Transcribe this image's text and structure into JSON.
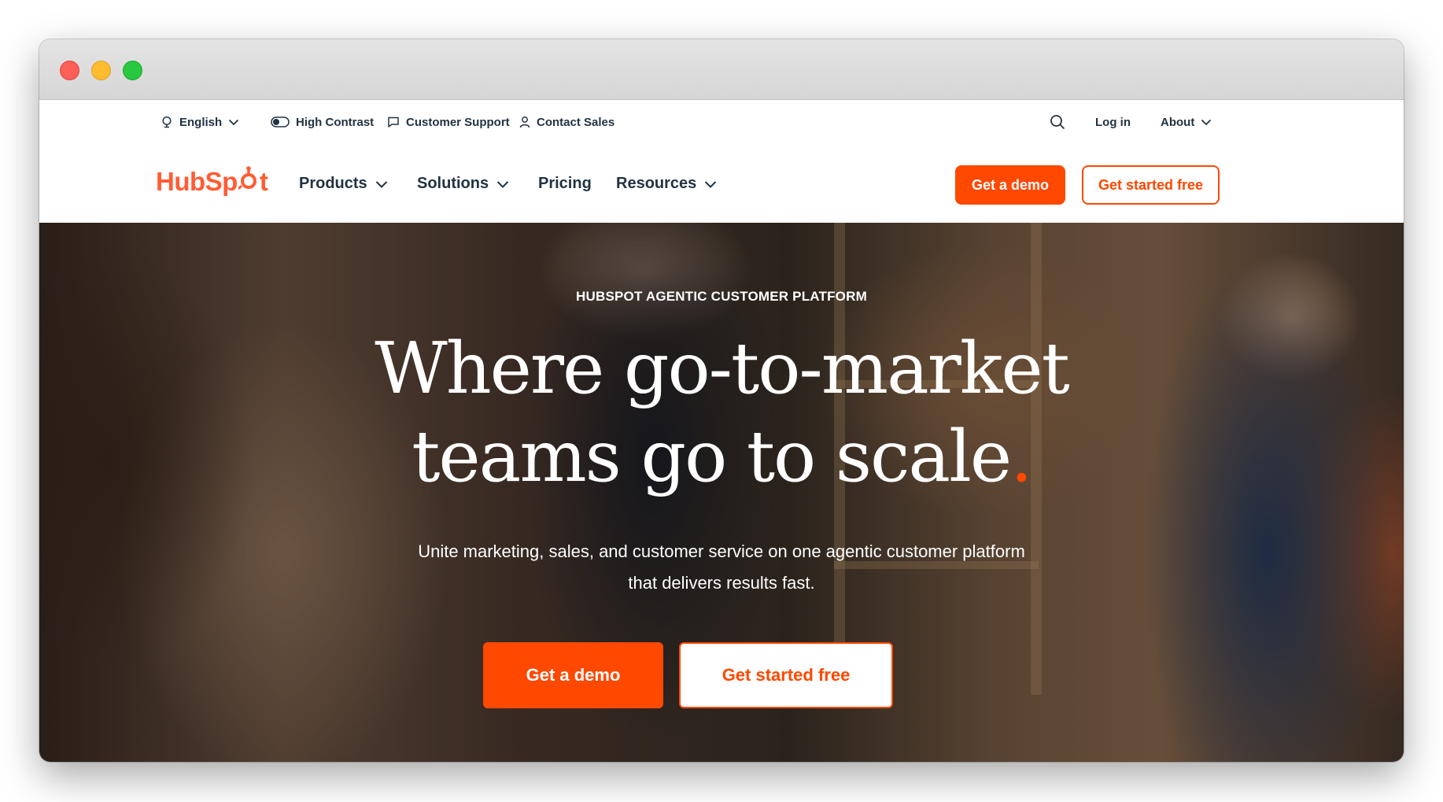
{
  "utility_bar": {
    "language": {
      "label": "English",
      "icon": "globe-icon"
    },
    "high_contrast": {
      "label": "High Contrast",
      "icon": "toggle-icon"
    },
    "customer_support": {
      "label": "Customer Support",
      "icon": "chat-icon"
    },
    "contact_sales": {
      "label": "Contact Sales",
      "icon": "person-icon"
    },
    "search": {
      "icon": "search-icon"
    },
    "login": {
      "label": "Log in"
    },
    "about": {
      "label": "About"
    }
  },
  "main_nav": {
    "logo": {
      "text_left": "HubSp",
      "text_right": "t"
    },
    "items": [
      {
        "label": "Products",
        "has_dropdown": true
      },
      {
        "label": "Solutions",
        "has_dropdown": true
      },
      {
        "label": "Pricing",
        "has_dropdown": false
      },
      {
        "label": "Resources",
        "has_dropdown": true
      }
    ],
    "cta_demo": "Get a demo",
    "cta_free": "Get started free"
  },
  "hero": {
    "eyebrow": "HUBSPOT AGENTIC CUSTOMER PLATFORM",
    "headline_line1": "Where go-to-market",
    "headline_line2": "teams go to scale",
    "headline_dot": ".",
    "subtext": "Unite marketing, sales, and customer service on one agentic customer platform that delivers results fast.",
    "cta_demo": "Get a demo",
    "cta_free": "Get started free"
  },
  "colors": {
    "brand_orange": "#ff4800",
    "logo_orange": "#ff5c35",
    "nav_text": "#213343"
  }
}
